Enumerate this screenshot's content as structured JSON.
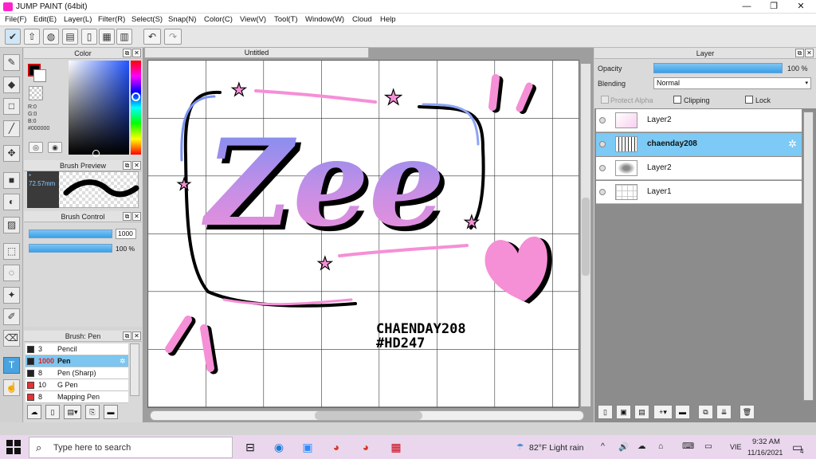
{
  "window": {
    "title": "JUMP PAINT (64bit)",
    "minimize": "—",
    "maximize": "❐",
    "close": "✕"
  },
  "menu": [
    "File(F)",
    "Edit(E)",
    "Layer(L)",
    "Filter(R)",
    "Select(S)",
    "Snap(N)",
    "Color(C)",
    "View(V)",
    "Tool(T)",
    "Window(W)",
    "Cloud",
    "Help"
  ],
  "toolbar": {
    "buttons": [
      "check-icon",
      "export-icon",
      "comment-icon",
      "chat-icon",
      "page-icon",
      "grid-icon",
      "layout-icon"
    ],
    "undo": "↶",
    "redo": "↷"
  },
  "tools": [
    "brush-icon",
    "eraser-icon",
    "selection-rect-icon",
    "pen-icon",
    "move-icon",
    "fill-rect-icon",
    "bucket-icon",
    "gradient-icon",
    "lasso-icon",
    "lasso-free-icon",
    "magic-wand-icon",
    "select-pen-icon",
    "select-eraser-icon",
    "text-icon",
    "hand-icon"
  ],
  "color_panel": {
    "title": "Color",
    "r": "R:0",
    "g": "G:0",
    "b": "B:0",
    "hex": "#000000"
  },
  "brush_preview": {
    "title": "Brush Preview",
    "size": "72.57mm"
  },
  "brush_control": {
    "title": "Brush Control",
    "size_value": "1000",
    "opacity_value": "100 %"
  },
  "brush_list": {
    "title": "Brush: Pen",
    "items": [
      {
        "num": "3",
        "name": "Pencil",
        "color": "#222222"
      },
      {
        "num": "1000",
        "name": "Pen",
        "color": "#222222",
        "active": true
      },
      {
        "num": "8",
        "name": "Pen (Sharp)",
        "color": "#222222"
      },
      {
        "num": "10",
        "name": "G Pen",
        "color": "#e33333"
      },
      {
        "num": "8",
        "name": "Mapping Pen",
        "color": "#e33333"
      }
    ]
  },
  "canvas": {
    "tab": "Untitled",
    "art_text": "Zee",
    "signature_line1": "CHAENDAY208",
    "signature_line2": "#HD247"
  },
  "layer_panel": {
    "title": "Layer",
    "opacity_label": "Opacity",
    "opacity_value": "100 %",
    "blending_label": "Blending",
    "blending_value": "Normal",
    "protect_alpha": "Protect Alpha",
    "clipping": "Clipping",
    "lock": "Lock",
    "layers": [
      {
        "name": "Layer2"
      },
      {
        "name": "chaenday208",
        "active": true
      },
      {
        "name": "Layer2"
      },
      {
        "name": "Layer1"
      }
    ]
  },
  "taskbar": {
    "search_placeholder": "Type here to search",
    "weather": "82°F  Light rain",
    "lang": "VIE",
    "time": "9:32 AM",
    "date": "11/16/2021",
    "notif_count": "4"
  },
  "colors": {
    "accent": "#4aa3df",
    "pink": "#f58fd6",
    "blue": "#6b8cf5",
    "taskbar": "#ead7ee"
  }
}
